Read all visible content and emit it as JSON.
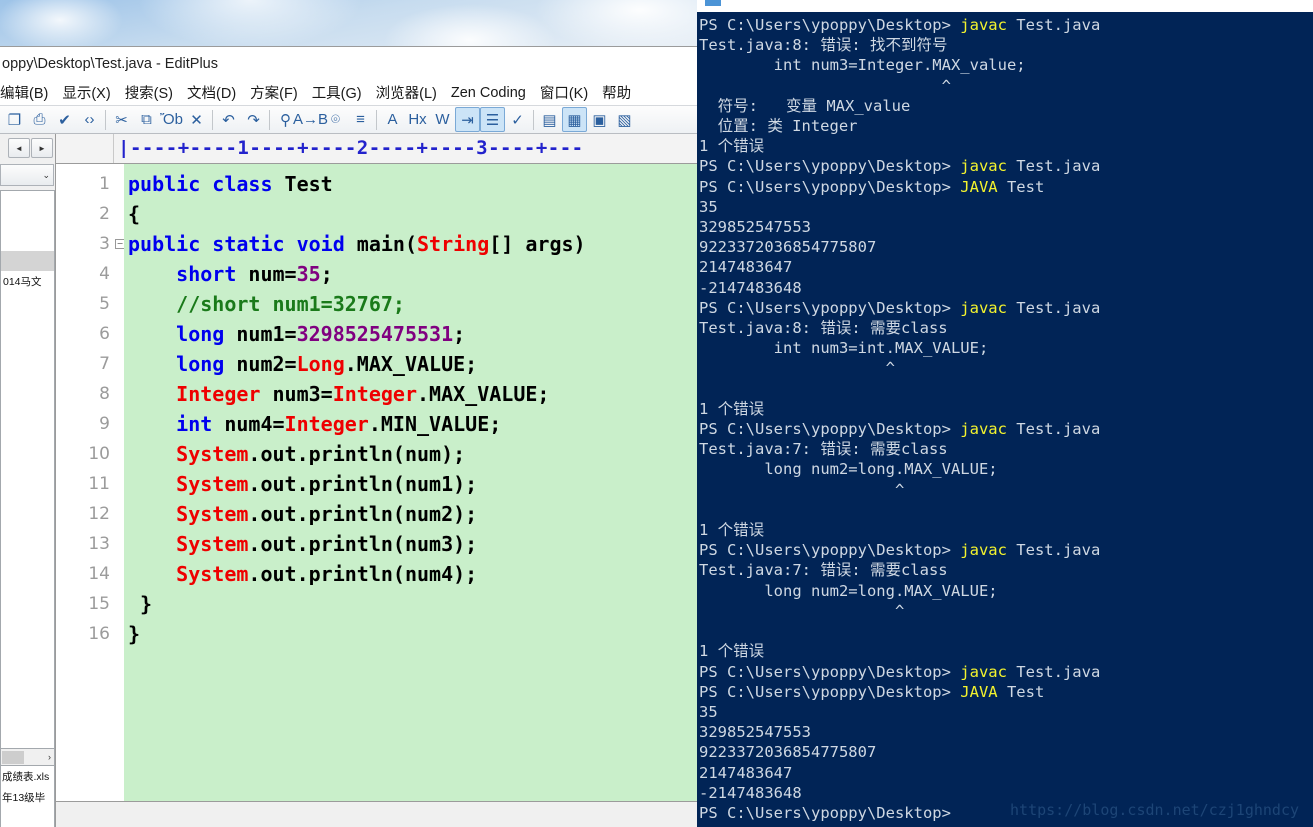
{
  "desktop": {
    "wallpaper_name": "clouds-sky-wallpaper"
  },
  "editor_window": {
    "title": "oppy\\Desktop\\Test.java - EditPlus",
    "menu": [
      {
        "label": "编辑(B)",
        "name": "menu-edit"
      },
      {
        "label": "显示(X)",
        "name": "menu-view"
      },
      {
        "label": "搜索(S)",
        "name": "menu-search"
      },
      {
        "label": "文档(D)",
        "name": "menu-document"
      },
      {
        "label": "方案(F)",
        "name": "menu-project"
      },
      {
        "label": "工具(G)",
        "name": "menu-tools"
      },
      {
        "label": "浏览器(L)",
        "name": "menu-browser"
      },
      {
        "label": "Zen Coding",
        "name": "menu-zen-coding"
      },
      {
        "label": "窗口(K)",
        "name": "menu-window"
      },
      {
        "label": "帮助",
        "name": "menu-help"
      }
    ],
    "toolbar": [
      {
        "name": "save-as-icon",
        "glyph": "❐",
        "selected": false
      },
      {
        "name": "print-icon",
        "glyph": "⎙",
        "selected": false
      },
      {
        "name": "spellcheck-icon",
        "glyph": "✔",
        "selected": false
      },
      {
        "name": "view-source-icon",
        "glyph": "‹›",
        "selected": false
      },
      {
        "sep": true
      },
      {
        "name": "cut-icon",
        "glyph": "✂",
        "selected": false
      },
      {
        "name": "copy-icon",
        "glyph": "⧉",
        "selected": false
      },
      {
        "name": "paste-icon",
        "glyph": "Ὄb",
        "selected": false
      },
      {
        "name": "delete-icon",
        "glyph": "✕",
        "selected": false
      },
      {
        "sep": true
      },
      {
        "name": "undo-icon",
        "glyph": "↶",
        "selected": false
      },
      {
        "name": "redo-icon",
        "glyph": "↷",
        "selected": false
      },
      {
        "sep": true
      },
      {
        "name": "find-icon",
        "glyph": "⚲",
        "selected": false
      },
      {
        "name": "replace-icon",
        "glyph": "A→B",
        "selected": false
      },
      {
        "name": "find-in-files-icon",
        "glyph": "⌾",
        "selected": false
      },
      {
        "name": "goto-line-icon",
        "glyph": "≡",
        "selected": false
      },
      {
        "sep": true
      },
      {
        "name": "font-icon",
        "glyph": "A",
        "selected": false
      },
      {
        "name": "hex-viewer-icon",
        "glyph": "Hx",
        "selected": false
      },
      {
        "name": "word-wrap-icon",
        "glyph": "W",
        "selected": false
      },
      {
        "name": "indent-icon",
        "glyph": "⇥",
        "selected": true
      },
      {
        "name": "line-numbers-icon",
        "glyph": "☰",
        "selected": true
      },
      {
        "name": "check-icon",
        "glyph": "✓",
        "selected": false
      },
      {
        "sep": true
      },
      {
        "name": "document-selector-icon",
        "glyph": "▤",
        "selected": false
      },
      {
        "name": "directory-window-icon",
        "glyph": "▦",
        "selected": true
      },
      {
        "name": "output-window-icon",
        "glyph": "▣",
        "selected": false
      },
      {
        "name": "clip-library-icon",
        "glyph": "▧",
        "selected": false
      }
    ],
    "sidebar": {
      "nav_back_icon": "◄",
      "nav_forward_icon": "►",
      "combo_chevron_icon": "⌄",
      "tree_rows": [
        "",
        "",
        "",
        "",
        "014马文",
        "",
        "",
        "",
        ""
      ],
      "tree_selected_index": 3,
      "hscroll_right_icon": "›",
      "file_rows": [
        "成绩表.xls",
        "年13级毕"
      ]
    },
    "ruler": "|----+----1----+----2----+----3----+---",
    "code_lines": [
      {
        "num": 1,
        "fold": false,
        "tokens": [
          {
            "t": "public class ",
            "c": "kw"
          },
          {
            "t": "Test",
            "c": "plain"
          }
        ]
      },
      {
        "num": 2,
        "fold": false,
        "tokens": [
          {
            "t": "{",
            "c": "plain"
          }
        ]
      },
      {
        "num": 3,
        "fold": true,
        "tokens": [
          {
            "t": "public static void ",
            "c": "kw"
          },
          {
            "t": "main(",
            "c": "plain"
          },
          {
            "t": "String",
            "c": "cls"
          },
          {
            "t": "[] args)",
            "c": "plain"
          }
        ]
      },
      {
        "num": 4,
        "fold": false,
        "tokens": [
          {
            "t": "    ",
            "c": "plain"
          },
          {
            "t": "short",
            "c": "kw"
          },
          {
            "t": " num=",
            "c": "plain"
          },
          {
            "t": "35",
            "c": "num"
          },
          {
            "t": ";",
            "c": "plain"
          }
        ]
      },
      {
        "num": 5,
        "fold": false,
        "tokens": [
          {
            "t": "    ",
            "c": "plain"
          },
          {
            "t": "//short num1=32767;",
            "c": "cmt"
          }
        ]
      },
      {
        "num": 6,
        "fold": false,
        "tokens": [
          {
            "t": "    ",
            "c": "plain"
          },
          {
            "t": "long",
            "c": "kw"
          },
          {
            "t": " num1=",
            "c": "plain"
          },
          {
            "t": "3298525475531",
            "c": "num"
          },
          {
            "t": ";",
            "c": "plain"
          }
        ]
      },
      {
        "num": 7,
        "fold": false,
        "tokens": [
          {
            "t": "    ",
            "c": "plain"
          },
          {
            "t": "long",
            "c": "kw"
          },
          {
            "t": " num2=",
            "c": "plain"
          },
          {
            "t": "Long",
            "c": "cls"
          },
          {
            "t": ".MAX_VALUE;",
            "c": "plain"
          }
        ]
      },
      {
        "num": 8,
        "fold": false,
        "tokens": [
          {
            "t": "    ",
            "c": "plain"
          },
          {
            "t": "Integer",
            "c": "cls"
          },
          {
            "t": " num3=",
            "c": "plain"
          },
          {
            "t": "Integer",
            "c": "cls"
          },
          {
            "t": ".MAX_VALUE;",
            "c": "plain"
          }
        ]
      },
      {
        "num": 9,
        "fold": false,
        "tokens": [
          {
            "t": "    ",
            "c": "plain"
          },
          {
            "t": "int",
            "c": "kw"
          },
          {
            "t": " num4=",
            "c": "plain"
          },
          {
            "t": "Integer",
            "c": "cls"
          },
          {
            "t": ".MIN_VALUE;",
            "c": "plain"
          }
        ]
      },
      {
        "num": 10,
        "fold": false,
        "tokens": [
          {
            "t": "    ",
            "c": "plain"
          },
          {
            "t": "System",
            "c": "cls"
          },
          {
            "t": ".out.println(num);",
            "c": "plain"
          }
        ]
      },
      {
        "num": 11,
        "fold": false,
        "tokens": [
          {
            "t": "    ",
            "c": "plain"
          },
          {
            "t": "System",
            "c": "cls"
          },
          {
            "t": ".out.println(num1);",
            "c": "plain"
          }
        ]
      },
      {
        "num": 12,
        "fold": false,
        "tokens": [
          {
            "t": "    ",
            "c": "plain"
          },
          {
            "t": "System",
            "c": "cls"
          },
          {
            "t": ".out.println(num2);",
            "c": "plain"
          }
        ]
      },
      {
        "num": 13,
        "fold": false,
        "tokens": [
          {
            "t": "    ",
            "c": "plain"
          },
          {
            "t": "System",
            "c": "cls"
          },
          {
            "t": ".out.println(num3);",
            "c": "plain"
          }
        ]
      },
      {
        "num": 14,
        "fold": false,
        "tokens": [
          {
            "t": "    ",
            "c": "plain"
          },
          {
            "t": "System",
            "c": "cls"
          },
          {
            "t": ".out.println(num4);",
            "c": "plain"
          }
        ]
      },
      {
        "num": 15,
        "fold": false,
        "tokens": [
          {
            "t": " }",
            "c": "plain"
          }
        ]
      },
      {
        "num": 16,
        "fold": false,
        "tokens": [
          {
            "t": "}",
            "c": "plain"
          }
        ]
      }
    ]
  },
  "terminal": {
    "lines": [
      {
        "prompt": "PS C:\\Users\\ypoppy\\Desktop> ",
        "cmd": "javac",
        "rest": " Test.java"
      },
      {
        "text": "Test.java:8: 错误: 找不到符号"
      },
      {
        "text": "        int num3=Integer.MAX_value;"
      },
      {
        "text": "                          ^"
      },
      {
        "text": "  符号:   变量 MAX_value"
      },
      {
        "text": "  位置: 类 Integer"
      },
      {
        "text": "1 个错误"
      },
      {
        "prompt": "PS C:\\Users\\ypoppy\\Desktop> ",
        "cmd": "javac",
        "rest": " Test.java"
      },
      {
        "prompt": "PS C:\\Users\\ypoppy\\Desktop> ",
        "cmd": "JAVA",
        "rest": " Test"
      },
      {
        "text": "35"
      },
      {
        "text": "329852547553"
      },
      {
        "text": "9223372036854775807"
      },
      {
        "text": "2147483647"
      },
      {
        "text": "-2147483648"
      },
      {
        "prompt": "PS C:\\Users\\ypoppy\\Desktop> ",
        "cmd": "javac",
        "rest": " Test.java"
      },
      {
        "text": "Test.java:8: 错误: 需要class"
      },
      {
        "text": "        int num3=int.MAX_VALUE;"
      },
      {
        "text": "                    ^"
      },
      {
        "text": ""
      },
      {
        "text": "1 个错误"
      },
      {
        "prompt": "PS C:\\Users\\ypoppy\\Desktop> ",
        "cmd": "javac",
        "rest": " Test.java"
      },
      {
        "text": "Test.java:7: 错误: 需要class"
      },
      {
        "text": "       long num2=long.MAX_VALUE;"
      },
      {
        "text": "                     ^"
      },
      {
        "text": ""
      },
      {
        "text": "1 个错误"
      },
      {
        "prompt": "PS C:\\Users\\ypoppy\\Desktop> ",
        "cmd": "javac",
        "rest": " Test.java"
      },
      {
        "text": "Test.java:7: 错误: 需要class"
      },
      {
        "text": "       long num2=long.MAX_VALUE;"
      },
      {
        "text": "                     ^"
      },
      {
        "text": ""
      },
      {
        "text": "1 个错误"
      },
      {
        "prompt": "PS C:\\Users\\ypoppy\\Desktop> ",
        "cmd": "javac",
        "rest": " Test.java"
      },
      {
        "prompt": "PS C:\\Users\\ypoppy\\Desktop> ",
        "cmd": "JAVA",
        "rest": " Test"
      },
      {
        "text": "35"
      },
      {
        "text": "329852547553"
      },
      {
        "text": "9223372036854775807"
      },
      {
        "text": "2147483647"
      },
      {
        "text": "-2147483648"
      },
      {
        "prompt": "PS C:\\Users\\ypoppy\\Desktop>",
        "cmd": "",
        "rest": ""
      }
    ],
    "watermark": "https://blog.csdn.net/czj1ghndcy",
    "colors": {
      "background": "#012456",
      "text": "#cfd8e3",
      "command": "#f3f32e"
    }
  }
}
